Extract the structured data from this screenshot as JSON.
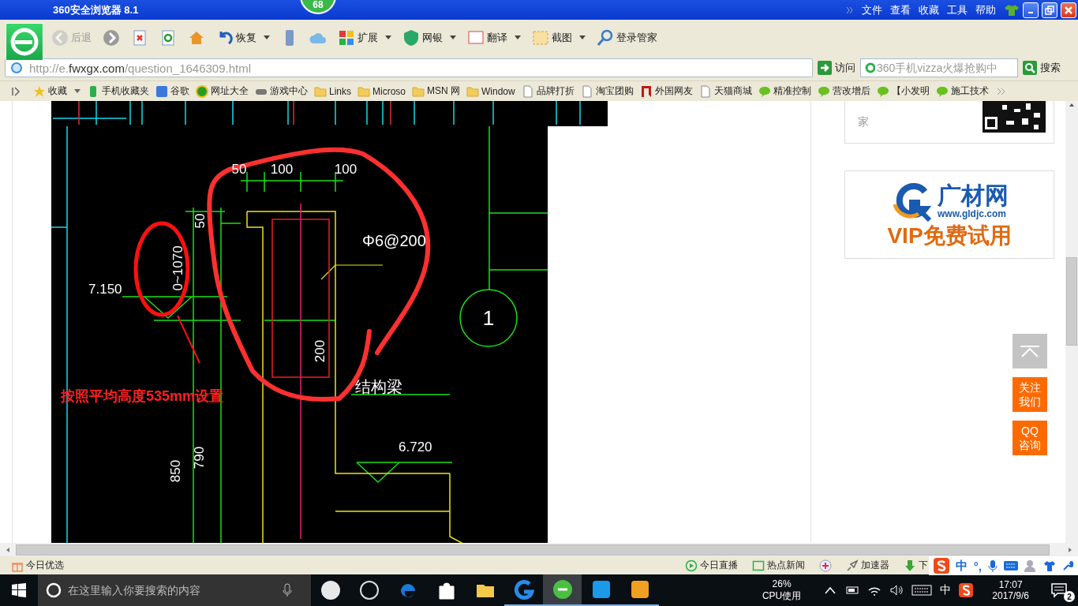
{
  "window": {
    "title": "360安全浏览器 8.1",
    "badge": "68",
    "menu": [
      "文件",
      "查看",
      "收藏",
      "工具",
      "帮助"
    ]
  },
  "toolbar": [
    {
      "kind": "back",
      "label": "后退",
      "disabled": true,
      "dropdown": false
    },
    {
      "kind": "forward",
      "disabled": false,
      "dropdown": false
    },
    {
      "kind": "stop",
      "disabled": false,
      "dropdown": false
    },
    {
      "kind": "refresh",
      "disabled": false,
      "dropdown": false
    },
    {
      "kind": "home",
      "disabled": false,
      "dropdown": false
    },
    {
      "kind": "restore",
      "label": "恢复",
      "disabled": false,
      "dropdown": true
    },
    {
      "kind": "phone",
      "disabled": false,
      "dropdown": false
    },
    {
      "kind": "cloud",
      "disabled": false,
      "dropdown": false
    },
    {
      "kind": "extend",
      "label": "扩展",
      "disabled": false,
      "dropdown": true
    },
    {
      "kind": "bank",
      "label": "网银",
      "disabled": false,
      "dropdown": true
    },
    {
      "kind": "translate",
      "label": "翻译",
      "disabled": false,
      "dropdown": true
    },
    {
      "kind": "screenshot",
      "label": "截图",
      "disabled": false,
      "dropdown": true
    },
    {
      "kind": "login",
      "label": "登录管家",
      "disabled": false,
      "dropdown": false
    }
  ],
  "address_bar": {
    "url": {
      "scheme": "http://e.",
      "domain": "fwxgx.com",
      "path": "/question_1646309.html"
    },
    "go_button": "访问",
    "search_placeholder": "360手机vizza火爆抢购中",
    "search_button": "搜索"
  },
  "bookmarks": [
    {
      "kind": "star",
      "label": "收藏",
      "dropdown": true
    },
    {
      "kind": "phone",
      "label": "手机收藏夹",
      "dropdown": false
    },
    {
      "kind": "google",
      "label": "谷歌",
      "dropdown": false
    },
    {
      "kind": "globe",
      "label": "网址大全",
      "dropdown": false
    },
    {
      "kind": "game",
      "label": "游戏中心",
      "dropdown": false
    },
    {
      "kind": "folder",
      "label": "Links",
      "dropdown": false
    },
    {
      "kind": "folder",
      "label": "Microso",
      "dropdown": false
    },
    {
      "kind": "folder",
      "label": "MSN 网",
      "dropdown": false
    },
    {
      "kind": "folder",
      "label": "Window",
      "dropdown": false
    },
    {
      "kind": "page",
      "label": "品牌打折",
      "dropdown": false
    },
    {
      "kind": "page",
      "label": "淘宝团购",
      "dropdown": false
    },
    {
      "kind": "flag",
      "label": "外国网友",
      "dropdown": false
    },
    {
      "kind": "page",
      "label": "天猫商城",
      "dropdown": false
    },
    {
      "kind": "chat",
      "label": "精准控制",
      "dropdown": false
    },
    {
      "kind": "chat",
      "label": "营改增后",
      "dropdown": false
    },
    {
      "kind": "chat",
      "label": "【小发明",
      "dropdown": false
    },
    {
      "kind": "chat",
      "label": "施工技术",
      "dropdown": false
    }
  ],
  "drawing": {
    "labels": [
      {
        "kind": "dimension",
        "text": "50"
      },
      {
        "kind": "dimension",
        "text": "100"
      },
      {
        "kind": "dimension",
        "text": "100"
      },
      {
        "kind": "dimension",
        "text": "50"
      },
      {
        "kind": "dimension",
        "text": "Φ6@200"
      },
      {
        "kind": "dimension",
        "text": "0~1070"
      },
      {
        "kind": "dimension",
        "text": "7.150"
      },
      {
        "kind": "grid",
        "text": "1"
      },
      {
        "kind": "dimension",
        "text": "200"
      },
      {
        "kind": "note",
        "text": "按照平均高度535mm设置"
      },
      {
        "kind": "dimension",
        "text": "结构梁"
      },
      {
        "kind": "dimension",
        "text": "6.720"
      },
      {
        "kind": "dimension",
        "text": "790"
      },
      {
        "kind": "dimension",
        "text": "850"
      }
    ]
  },
  "sidebar": {
    "app_card_text": "家",
    "banner": {
      "brand": "广材网",
      "url": "www.gldjc.com",
      "offer": "VIP免费试用"
    }
  },
  "float_buttons": [
    {
      "kind": "top"
    },
    {
      "kind": "text",
      "label": "关注我们"
    },
    {
      "kind": "text",
      "label": "QQ咨询"
    }
  ],
  "status_bar": {
    "left": [
      {
        "kind": "gift",
        "label": "今日优选"
      }
    ],
    "right": [
      {
        "kind": "play",
        "label": "今日直播"
      },
      {
        "kind": "news",
        "label": "热点新闻"
      },
      {
        "kind": "medic"
      },
      {
        "kind": "rocket",
        "label": "加速器"
      },
      {
        "kind": "download",
        "label": "下"
      }
    ]
  },
  "ime_bar": {
    "mode": "中",
    "punctuation": "°,"
  },
  "taskbar": {
    "search_placeholder": "在这里输入你要搜索的内容",
    "apps": [
      {
        "kind": "pinwheel",
        "running": false,
        "selected": false
      },
      {
        "kind": "swirl",
        "running": false,
        "selected": false
      },
      {
        "kind": "edge",
        "running": false,
        "selected": false
      },
      {
        "kind": "store",
        "running": false,
        "selected": false
      },
      {
        "kind": "explorer",
        "running": false,
        "selected": false
      },
      {
        "kind": "g-app",
        "running": true,
        "selected": false
      },
      {
        "kind": "browser",
        "running": true,
        "selected": true
      },
      {
        "kind": "pin-app",
        "running": true,
        "selected": false
      },
      {
        "kind": "notes",
        "running": true,
        "selected": false
      }
    ],
    "cpu": {
      "value": "26%",
      "label": "CPU使用"
    },
    "ime": "中",
    "clock": {
      "time": "17:07",
      "date": "2017/9/6"
    },
    "notifications": "2"
  }
}
